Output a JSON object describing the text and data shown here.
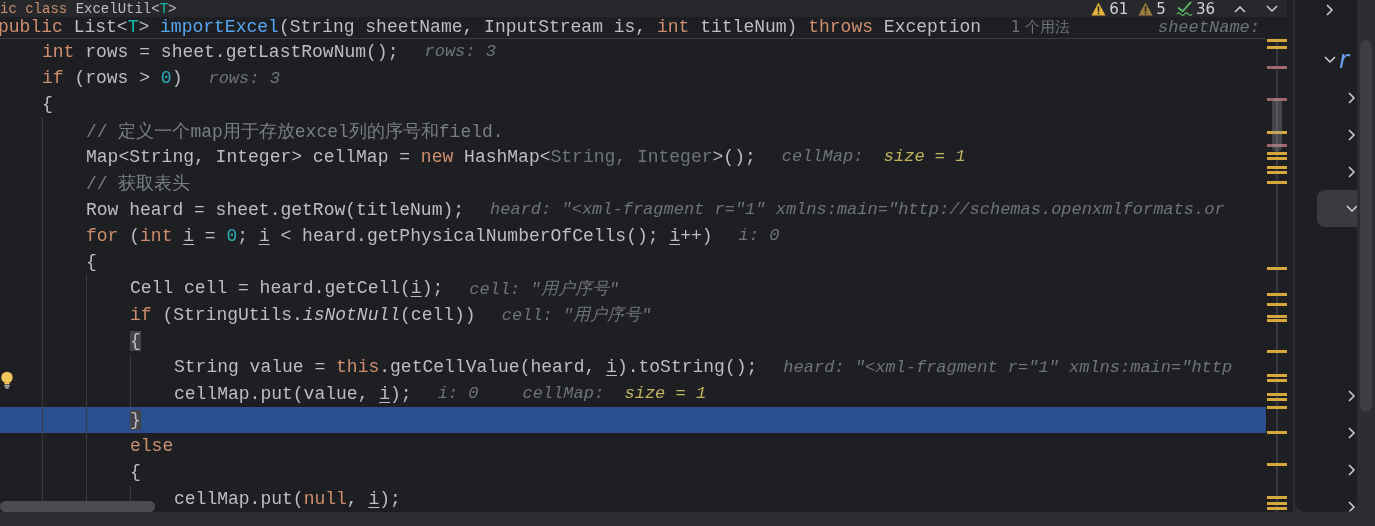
{
  "sticky_lines": [
    {
      "tokens": [
        {
          "text": "ic class ",
          "kind": "keyword"
        },
        {
          "text": "ExcelUtil<",
          "kind": "plain"
        },
        {
          "text": "T",
          "kind": "type-param"
        },
        {
          "text": ">",
          "kind": "plain"
        }
      ]
    },
    {
      "tokens": [
        {
          "text": "public ",
          "kind": "keyword"
        },
        {
          "text": "List<",
          "kind": "plain"
        },
        {
          "text": "T",
          "kind": "type-param"
        },
        {
          "text": "> ",
          "kind": "plain"
        },
        {
          "text": "importExcel",
          "kind": "method"
        },
        {
          "text": "(String sheetName, InputStream is, ",
          "kind": "plain"
        },
        {
          "text": "int ",
          "kind": "keyword"
        },
        {
          "text": "titleNum) ",
          "kind": "plain"
        },
        {
          "text": "throws ",
          "kind": "keyword"
        },
        {
          "text": "Exception",
          "kind": "plain"
        }
      ],
      "hints": [
        {
          "kind": "usages",
          "parts": [
            {
              "text": "1 个用法",
              "kind": "label"
            }
          ]
        },
        {
          "kind": "trailing",
          "parts": [
            {
              "text": "sheetName:",
              "kind": "label"
            }
          ]
        }
      ]
    }
  ],
  "lines": [
    {
      "current": false,
      "intention": false,
      "tokens": [
        {
          "text": "int ",
          "kind": "keyword"
        },
        {
          "text": "rows = sheet.getLastRowNum();",
          "kind": "plain"
        }
      ],
      "hints": [
        {
          "kind": "inlay",
          "parts": [
            {
              "text": "rows: 3",
              "kind": "label"
            }
          ]
        }
      ]
    },
    {
      "current": false,
      "intention": false,
      "tokens": [
        {
          "text": "if ",
          "kind": "keyword"
        },
        {
          "text": "(rows > ",
          "kind": "plain"
        },
        {
          "text": "0",
          "kind": "number"
        },
        {
          "text": ")",
          "kind": "plain"
        }
      ],
      "hints": [
        {
          "kind": "inlay",
          "parts": [
            {
              "text": "rows: 3",
              "kind": "label"
            }
          ]
        }
      ]
    },
    {
      "current": false,
      "intention": false,
      "tokens": [
        {
          "text": "{",
          "kind": "plain"
        }
      ],
      "children": [
        {
          "current": false,
          "intention": false,
          "tokens": [
            {
              "text": "// 定义一个map用于存放excel列的序号和field.",
              "kind": "comment"
            }
          ]
        },
        {
          "current": false,
          "intention": false,
          "tokens": [
            {
              "text": "Map<String, Integer> cellMap = ",
              "kind": "plain"
            },
            {
              "text": "new ",
              "kind": "keyword"
            },
            {
              "text": "HashMap<",
              "kind": "plain"
            },
            {
              "text": "String, Integer",
              "kind": "dim"
            },
            {
              "text": ">();",
              "kind": "plain"
            }
          ],
          "hints": [
            {
              "kind": "inlay",
              "parts": [
                {
                  "text": "cellMap:  ",
                  "kind": "label"
                },
                {
                  "text": "size = 1",
                  "kind": "summary"
                }
              ]
            }
          ]
        },
        {
          "current": false,
          "intention": false,
          "tokens": [
            {
              "text": "// 获取表头",
              "kind": "comment"
            }
          ]
        },
        {
          "current": false,
          "intention": false,
          "tokens": [
            {
              "text": "Row heard = sheet.getRow(titleNum);",
              "kind": "plain"
            }
          ],
          "hints": [
            {
              "kind": "inlay",
              "parts": [
                {
                  "text": "heard: \"<xml-fragment r=\"1\" xmlns:main=\"http://schemas.openxmlformats.or",
                  "kind": "label"
                }
              ]
            }
          ]
        },
        {
          "current": false,
          "intention": false,
          "tokens": [
            {
              "text": "for ",
              "kind": "keyword"
            },
            {
              "text": "(",
              "kind": "plain"
            },
            {
              "text": "int ",
              "kind": "keyword"
            },
            {
              "text": "i",
              "kind": "variable"
            },
            {
              "text": " = ",
              "kind": "plain"
            },
            {
              "text": "0",
              "kind": "number"
            },
            {
              "text": "; ",
              "kind": "plain"
            },
            {
              "text": "i",
              "kind": "variable"
            },
            {
              "text": " < heard.getPhysicalNumberOfCells(); ",
              "kind": "plain"
            },
            {
              "text": "i",
              "kind": "variable"
            },
            {
              "text": "++)",
              "kind": "plain"
            }
          ],
          "hints": [
            {
              "kind": "inlay",
              "parts": [
                {
                  "text": "i: 0",
                  "kind": "label"
                }
              ]
            }
          ]
        },
        {
          "current": false,
          "intention": false,
          "tokens": [
            {
              "text": "{",
              "kind": "plain"
            }
          ],
          "children": [
            {
              "current": false,
              "intention": false,
              "tokens": [
                {
                  "text": "Cell cell = heard.getCell(",
                  "kind": "plain"
                },
                {
                  "text": "i",
                  "kind": "variable"
                },
                {
                  "text": ");",
                  "kind": "plain"
                }
              ],
              "hints": [
                {
                  "kind": "inlay",
                  "parts": [
                    {
                      "text": "cell: \"用户序号\"",
                      "kind": "label"
                    }
                  ]
                }
              ]
            },
            {
              "current": false,
              "intention": false,
              "tokens": [
                {
                  "text": "if ",
                  "kind": "keyword"
                },
                {
                  "text": "(StringUtils.",
                  "kind": "plain"
                },
                {
                  "text": "isNotNull",
                  "kind": "static"
                },
                {
                  "text": "(cell))",
                  "kind": "plain"
                }
              ],
              "hints": [
                {
                  "kind": "inlay",
                  "parts": [
                    {
                      "text": "cell: \"用户序号\"",
                      "kind": "label"
                    }
                  ]
                }
              ]
            },
            {
              "current": false,
              "intention": false,
              "tokens": [
                {
                  "text": "{",
                  "kind": "brace-match"
                }
              ],
              "children": [
                {
                  "current": false,
                  "intention": false,
                  "tokens": [
                    {
                      "text": "String value = ",
                      "kind": "plain"
                    },
                    {
                      "text": "this",
                      "kind": "keyword"
                    },
                    {
                      "text": ".getCellValue(heard, ",
                      "kind": "plain"
                    },
                    {
                      "text": "i",
                      "kind": "variable"
                    },
                    {
                      "text": ").toString();",
                      "kind": "plain"
                    }
                  ],
                  "hints": [
                    {
                      "kind": "inlay",
                      "parts": [
                        {
                          "text": "heard: \"<xml-fragment r=\"1\" xmlns:main=\"http",
                          "kind": "label"
                        }
                      ]
                    }
                  ]
                },
                {
                  "current": false,
                  "intention": true,
                  "tokens": [
                    {
                      "text": "cellMap.put(value, ",
                      "kind": "plain"
                    },
                    {
                      "text": "i",
                      "kind": "variable"
                    },
                    {
                      "text": ");",
                      "kind": "plain"
                    }
                  ],
                  "hints": [
                    {
                      "kind": "inlay",
                      "parts": [
                        {
                          "text": "i: 0",
                          "kind": "label"
                        }
                      ]
                    },
                    {
                      "kind": "inlay",
                      "parts": [
                        {
                          "text": "cellMap:  ",
                          "kind": "label"
                        },
                        {
                          "text": "size = 1",
                          "kind": "summary"
                        }
                      ]
                    }
                  ]
                }
              ]
            },
            {
              "current": true,
              "intention": false,
              "tokens": [
                {
                  "text": "}",
                  "kind": "brace-match"
                }
              ]
            },
            {
              "current": false,
              "intention": false,
              "tokens": [
                {
                  "text": "else",
                  "kind": "keyword"
                }
              ]
            },
            {
              "current": false,
              "intention": false,
              "tokens": [
                {
                  "text": "{",
                  "kind": "plain"
                }
              ],
              "children": [
                {
                  "current": false,
                  "intention": false,
                  "tokens": [
                    {
                      "text": "cellMap.put(",
                      "kind": "plain"
                    },
                    {
                      "text": "null",
                      "kind": "keyword"
                    },
                    {
                      "text": ", ",
                      "kind": "plain"
                    },
                    {
                      "text": "i",
                      "kind": "variable"
                    },
                    {
                      "text": ");",
                      "kind": "plain"
                    }
                  ]
                }
              ]
            }
          ]
        }
      ]
    }
  ],
  "inspections": [
    {
      "kind": "warning",
      "count": "61"
    },
    {
      "kind": "weak-warning",
      "count": "5"
    },
    {
      "kind": "typo",
      "count": "36"
    }
  ],
  "structure": {
    "nodes": [
      {
        "expanded": false,
        "selected": false
      },
      {
        "expanded": true,
        "selected": false,
        "label": "r",
        "children": [
          {
            "expanded": false,
            "selected": false
          },
          {
            "expanded": false,
            "selected": false
          },
          {
            "expanded": false,
            "selected": false
          },
          {
            "expanded": true,
            "selected": true
          },
          {
            "expanded": false,
            "selected": false
          },
          {
            "expanded": false,
            "selected": false
          },
          {
            "expanded": false,
            "selected": false
          },
          {
            "expanded": false,
            "selected": false
          }
        ]
      }
    ]
  }
}
